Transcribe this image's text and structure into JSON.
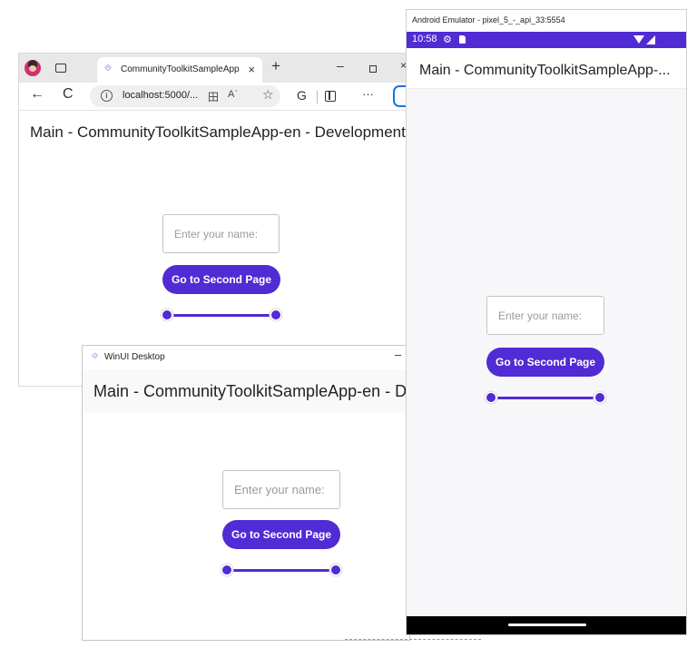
{
  "browser": {
    "tab_title": "CommunityToolkitSampleApp",
    "tab_close": "×",
    "new_tab": "+",
    "min_glyph": "–",
    "close_glyph": "×",
    "back_glyph": "←",
    "refresh_glyph": "C",
    "address": "localhost:5000/...",
    "apps_glyph": "田",
    "read_glyph": "Aʾ",
    "fav_glyph": "☆",
    "ext_glyph": "G",
    "more_glyph": "···",
    "page_title": "Main - CommunityToolkitSampleApp-en - Development",
    "entry_placeholder": "Enter your name:",
    "button_label": "Go to Second Page"
  },
  "winui": {
    "title": "WinUI Desktop",
    "min_glyph": "–",
    "page_title": "Main - CommunityToolkitSampleApp-en - Deve",
    "entry_placeholder": "Enter your name:",
    "button_label": "Go to Second Page"
  },
  "android": {
    "emulator_title": "Android Emulator - pixel_5_-_api_33:5554",
    "time": "10:58",
    "gear_glyph": "⚙",
    "page_title": "Main - CommunityToolkitSampleApp-...",
    "entry_placeholder": "Enter your name:",
    "button_label": "Go to Second Page"
  },
  "colors": {
    "accent": "#512bd4",
    "status_bar": "#512bd4"
  }
}
